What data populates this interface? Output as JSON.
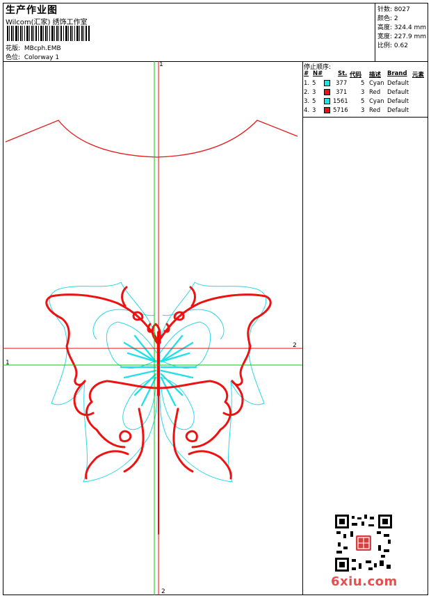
{
  "header": {
    "title": "生产作业图",
    "company": "Wilcom(汇家) 绣饰工作室",
    "design_label": "花版:",
    "design_value": "MBcph.EMB",
    "colorway_label": "色位:",
    "colorway_value": "Colorway 1"
  },
  "stats": [
    {
      "label": "针数:",
      "value": "8027"
    },
    {
      "label": "颜色:",
      "value": "2"
    },
    {
      "label": "高度:",
      "value": "324.4 mm"
    },
    {
      "label": "宽度:",
      "value": "227.9 mm"
    },
    {
      "label": "比例:",
      "value": "0.62"
    }
  ],
  "stop_sequence": {
    "title": "停止顺序:",
    "headers": [
      "#",
      "N#",
      "St.",
      "代码",
      "描述",
      "Brand",
      "元素"
    ],
    "rows": [
      {
        "num": "1.",
        "needle": "5",
        "stitches": "377",
        "code": "5",
        "desc": "Cyan",
        "brand": "Default",
        "color": "#22e0e8"
      },
      {
        "num": "2.",
        "needle": "3",
        "stitches": "371",
        "code": "3",
        "desc": "Red",
        "brand": "Default",
        "color": "#ee1111"
      },
      {
        "num": "3.",
        "needle": "5",
        "stitches": "1561",
        "code": "5",
        "desc": "Cyan",
        "brand": "Default",
        "color": "#22e0e8"
      },
      {
        "num": "4.",
        "needle": "3",
        "stitches": "5716",
        "code": "3",
        "desc": "Red",
        "brand": "Default",
        "color": "#ee1111"
      }
    ]
  },
  "axis_labels": {
    "top": "1",
    "bottom": "2",
    "left": "1",
    "right": "2"
  },
  "colors": {
    "thread_red": "#ee1111",
    "thread_cyan": "#22e0e8",
    "axis_red": "#ff0000",
    "axis_green": "#00cc00"
  },
  "watermark": {
    "text": "6xiu.com"
  }
}
